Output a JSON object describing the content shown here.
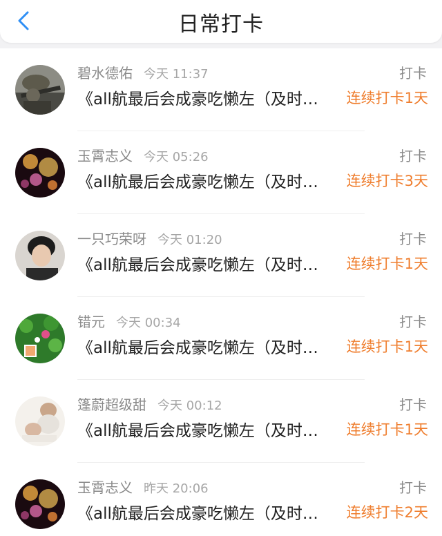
{
  "header": {
    "title": "日常打卡",
    "back_icon": "chevron-left-icon",
    "accent_color": "#2f8ff5"
  },
  "records": [
    {
      "name": "碧水德佑",
      "time": "今天 11:37",
      "action": "打卡",
      "content": "《all航最后会成豪吃懒左（及时…",
      "streak": "连续打卡1天"
    },
    {
      "name": "玉霄志义",
      "time": "今天 05:26",
      "action": "打卡",
      "content": "《all航最后会成豪吃懒左（及时…",
      "streak": "连续打卡3天"
    },
    {
      "name": "一只巧荣呀",
      "time": "今天 01:20",
      "action": "打卡",
      "content": "《all航最后会成豪吃懒左（及时…",
      "streak": "连续打卡1天"
    },
    {
      "name": "错元",
      "time": "今天 00:34",
      "action": "打卡",
      "content": "《all航最后会成豪吃懒左（及时…",
      "streak": "连续打卡1天"
    },
    {
      "name": "篷蔚超级甜",
      "time": "今天 00:12",
      "action": "打卡",
      "content": "《all航最后会成豪吃懒左（及时…",
      "streak": "连续打卡1天"
    },
    {
      "name": "玉霄志义",
      "time": "昨天 20:06",
      "action": "打卡",
      "content": "《all航最后会成豪吃懒左（及时…",
      "streak": "连续打卡2天"
    }
  ],
  "colors": {
    "streak": "#ef7d2d",
    "name": "#8a8a8a",
    "content": "#222222"
  }
}
